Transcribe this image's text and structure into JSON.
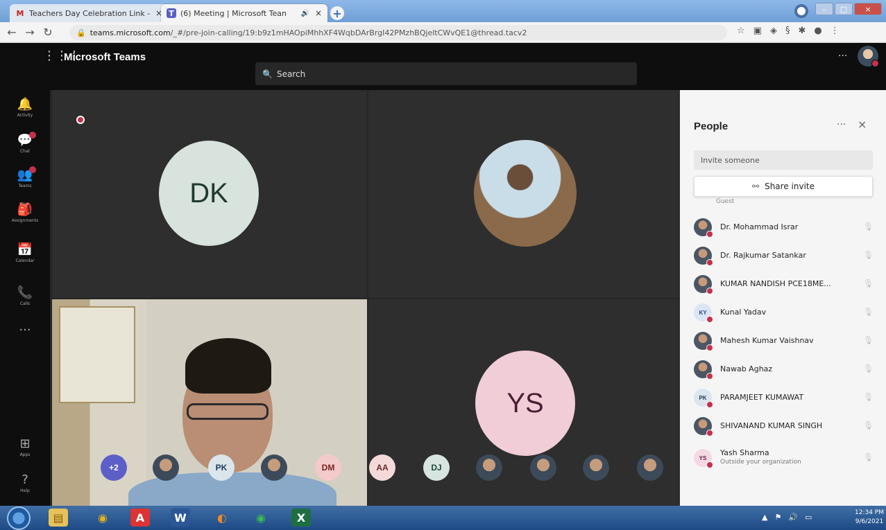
{
  "browser": {
    "tabs": [
      {
        "favicon": "M",
        "title": "Teachers Day Celebration Link - | "
      },
      {
        "favicon": "T",
        "title": "(6) Meeting | Microsoft Tean"
      }
    ],
    "tab_close_glyph": "×",
    "new_tab_glyph": "+",
    "url_domain": "teams.microsoft.com",
    "url_path": "/_#/pre-join-calling/19:b9z1mHAOpiMhhXF4WqbDArBrgI42PMzhBQjeltCWvQE1@thread.tacv2",
    "window_controls": [
      "–",
      "□",
      "×"
    ]
  },
  "teams": {
    "title": "Microsoft Teams",
    "search_placeholder": "Search",
    "header_more": "···"
  },
  "rail": [
    {
      "label": "Activity",
      "icon": "bell-icon",
      "glyph": "🔔",
      "badge": false
    },
    {
      "label": "Chat",
      "icon": "chat-icon",
      "glyph": "💬",
      "badge": true
    },
    {
      "label": "Teams",
      "icon": "teams-icon",
      "glyph": "👥",
      "badge": true
    },
    {
      "label": "Assignments",
      "icon": "assignments-icon",
      "glyph": "🎒",
      "badge": false
    },
    {
      "label": "Calendar",
      "icon": "calendar-icon",
      "glyph": "📅",
      "badge": false
    },
    {
      "label": "Calls",
      "icon": "phone-icon",
      "glyph": "📞",
      "badge": false
    },
    {
      "label": "",
      "icon": "more-icon",
      "glyph": "···",
      "badge": false
    },
    {
      "label": "Apps",
      "icon": "apps-icon",
      "glyph": "⊞",
      "badge": false
    },
    {
      "label": "Help",
      "icon": "help-icon",
      "glyph": "?",
      "badge": false
    }
  ],
  "stage": {
    "tile_dk_initials": "DK",
    "tile_ys_initials": "YS"
  },
  "strip": [
    {
      "text": "+2",
      "kind": "more"
    },
    {
      "text": "",
      "kind": "photo"
    },
    {
      "text": "PK",
      "kind": "pk"
    },
    {
      "text": "",
      "kind": "photo"
    },
    {
      "text": "DM",
      "kind": "dm"
    },
    {
      "text": "AA",
      "kind": "aa"
    },
    {
      "text": "DJ",
      "kind": "dj"
    },
    {
      "text": "",
      "kind": "photo"
    },
    {
      "text": "",
      "kind": "photo"
    },
    {
      "text": "",
      "kind": "photo"
    },
    {
      "text": "",
      "kind": "photo"
    }
  ],
  "people": {
    "title": "People",
    "more": "···",
    "close": "×",
    "invite_placeholder": "Invite someone",
    "share_invite": "Share invite",
    "partial_guest": "Guest",
    "list": [
      {
        "name": "Dr. Mohammad Israr",
        "sub": "",
        "avatar": "",
        "kind": "ph"
      },
      {
        "name": "Dr. Rajkumar Satankar",
        "sub": "",
        "avatar": "",
        "kind": "ph"
      },
      {
        "name": "KUMAR NANDISH PCE18ME...",
        "sub": "",
        "avatar": "",
        "kind": "ph"
      },
      {
        "name": "Kunal Yadav",
        "sub": "",
        "avatar": "KY",
        "kind": "ky"
      },
      {
        "name": "Mahesh Kumar Vaishnav",
        "sub": "",
        "avatar": "",
        "kind": "ph"
      },
      {
        "name": "Nawab Aghaz",
        "sub": "",
        "avatar": "",
        "kind": "ph"
      },
      {
        "name": "PARAMJEET KUMAWAT",
        "sub": "",
        "avatar": "PK",
        "kind": "pk"
      },
      {
        "name": "SHIVANAND KUMAR SINGH",
        "sub": "",
        "avatar": "",
        "kind": "ph"
      },
      {
        "name": "Yash Sharma",
        "sub": "Outside your organization",
        "avatar": "YS",
        "kind": "ys"
      }
    ]
  },
  "taskbar": {
    "time": "12:34 PM",
    "date": "9/6/2021"
  },
  "colors": {
    "teams_purple": "#5b5fc7",
    "status_red": "#c4314b"
  }
}
